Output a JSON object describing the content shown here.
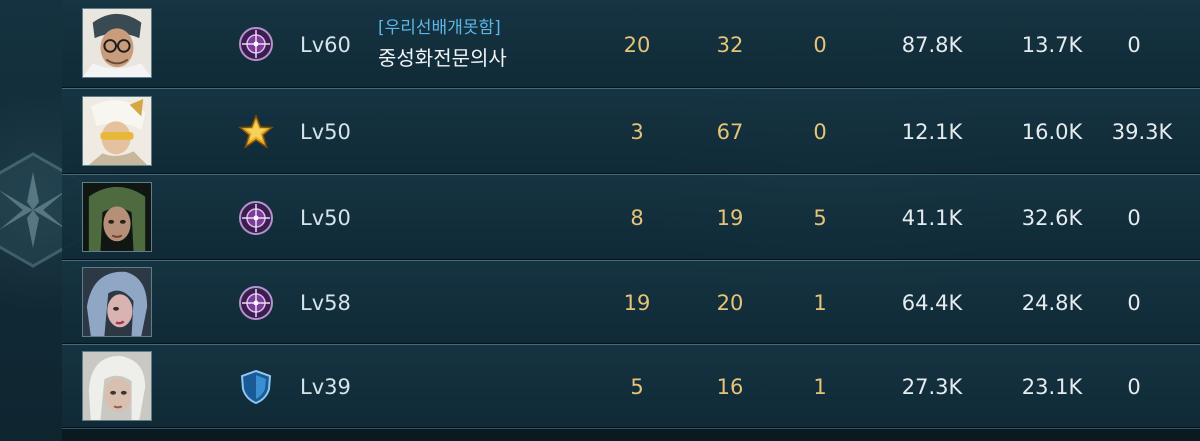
{
  "rows": [
    {
      "class_icon": "crosshair-icon",
      "level": "Lv60",
      "guild": "[우리선배개못함]",
      "name": "중성화전문의사",
      "kills": "20",
      "deaths": "32",
      "assists": "0",
      "damage": "87.8K",
      "taken": "13.7K",
      "heal": "0"
    },
    {
      "class_icon": "star-icon",
      "level": "Lv50",
      "guild": "",
      "name": "",
      "kills": "3",
      "deaths": "67",
      "assists": "0",
      "damage": "12.1K",
      "taken": "16.0K",
      "heal": "39.3K"
    },
    {
      "class_icon": "crosshair-icon",
      "level": "Lv50",
      "guild": "",
      "name": "",
      "kills": "8",
      "deaths": "19",
      "assists": "5",
      "damage": "41.1K",
      "taken": "32.6K",
      "heal": "0"
    },
    {
      "class_icon": "crosshair-icon",
      "level": "Lv58",
      "guild": "",
      "name": "",
      "kills": "19",
      "deaths": "20",
      "assists": "1",
      "damage": "64.4K",
      "taken": "24.8K",
      "heal": "0"
    },
    {
      "class_icon": "shield-icon",
      "level": "Lv39",
      "guild": "",
      "name": "",
      "kills": "5",
      "deaths": "16",
      "assists": "1",
      "damage": "27.3K",
      "taken": "23.1K",
      "heal": "0"
    }
  ],
  "colors": {
    "stat_gold": "#e7c377",
    "stat_white": "#e6ecee",
    "guild_blue": "#5db6e8",
    "row_bg": "#153442"
  }
}
